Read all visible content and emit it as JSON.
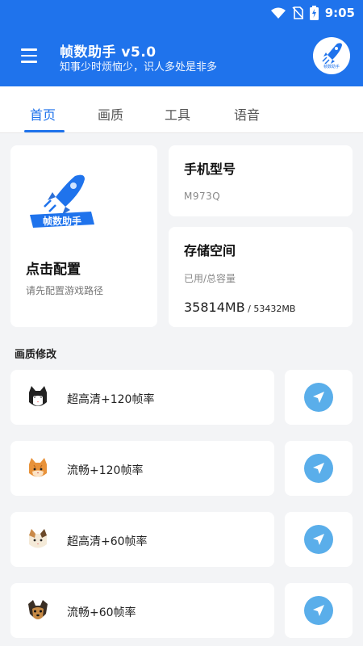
{
  "status_bar": {
    "time": "9:05"
  },
  "header": {
    "title": "帧数助手 v5.0",
    "subtitle": "知事少时烦恼少，识人多处是非多",
    "avatar_text": "帧数助手",
    "bg_color": "#1f73ec"
  },
  "tabs": [
    {
      "label": "首页",
      "active": true
    },
    {
      "label": "画质",
      "active": false
    },
    {
      "label": "工具",
      "active": false
    },
    {
      "label": "语音",
      "active": false
    }
  ],
  "config_card": {
    "logo_text": "帧数助手",
    "title": "点击配置",
    "desc": "请先配置游戏路径"
  },
  "model_card": {
    "title": "手机型号",
    "value": "M973Q"
  },
  "storage_card": {
    "title": "存储空间",
    "label": "已用/总容量",
    "used": "35814MB",
    "total": " / 53432MB"
  },
  "quality_section": {
    "title": "画质修改",
    "items": [
      {
        "label": "超高清+120帧率",
        "pet_icon": "cat-black-white-icon"
      },
      {
        "label": "流畅+120帧率",
        "pet_icon": "cat-orange-icon"
      },
      {
        "label": "超高清+60帧率",
        "pet_icon": "cat-calico-icon"
      },
      {
        "label": "流畅+60帧率",
        "pet_icon": "dog-yorkie-icon"
      }
    ]
  },
  "colors": {
    "accent": "#1f73ec",
    "send_button": "#5aaeea"
  }
}
